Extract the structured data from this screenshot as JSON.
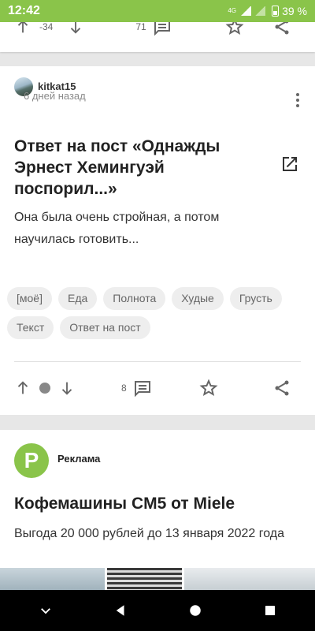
{
  "status": {
    "time": "12:42",
    "network": "4G",
    "battery": "39 %"
  },
  "prev_post": {
    "rating": "-34",
    "comments": "71"
  },
  "post": {
    "author": "kitkat15",
    "date": "6 дней назад",
    "title": "Ответ на пост «Однажды Эрнест Хемингуэй поспорил...»",
    "text": "Она была очень стройная, а потом научилась готовить...",
    "tags": [
      "[моё]",
      "Еда",
      "Полнота",
      "Худые",
      "Грусть",
      "Текст",
      "Ответ на пост"
    ],
    "comments": "8"
  },
  "ad": {
    "logo_letter": "P",
    "label": "Реклама",
    "title": "Кофемашины CM5 от Miele",
    "text": "Выгода 20 000 рублей до 13 января 2022 года"
  },
  "colors": {
    "accent": "#8ac44a",
    "background": "#e7e7e7",
    "tag_bg": "#eeeeee",
    "icon": "#666666"
  },
  "icons": [
    "arrow-up-icon",
    "arrow-down-icon",
    "comment-icon",
    "star-icon",
    "share-icon",
    "more-vert-icon",
    "open-in-new-icon"
  ]
}
